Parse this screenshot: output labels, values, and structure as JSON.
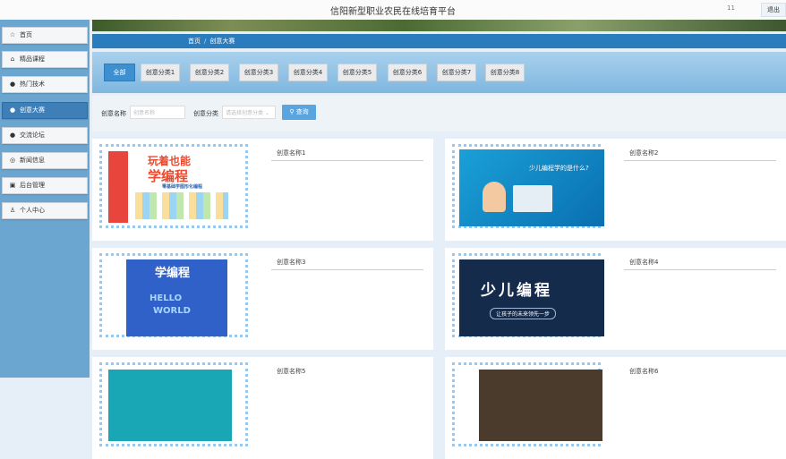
{
  "header": {
    "title": "信阳新型职业农民在线培育平台",
    "badge": "11",
    "logout": "退出"
  },
  "sidebar": {
    "items": [
      {
        "label": "首页",
        "icon": "☆"
      },
      {
        "label": "精品课程",
        "icon": "⌂"
      },
      {
        "label": "热门技术",
        "icon": "●"
      },
      {
        "label": "创意大赛",
        "icon": "●"
      },
      {
        "label": "交流论坛",
        "icon": "●"
      },
      {
        "label": "新闻信息",
        "icon": "◎"
      },
      {
        "label": "后台管理",
        "icon": "▣"
      },
      {
        "label": "个人中心",
        "icon": "♙"
      }
    ]
  },
  "breadcrumb": {
    "home": "首页",
    "separator": "/",
    "current": "创意大赛"
  },
  "tabs": [
    {
      "label": "全部"
    },
    {
      "label": "创意分类1"
    },
    {
      "label": "创意分类2"
    },
    {
      "label": "创意分类3"
    },
    {
      "label": "创意分类4"
    },
    {
      "label": "创意分类5"
    },
    {
      "label": "创意分类6"
    },
    {
      "label": "创意分类7"
    },
    {
      "label": "创意分类8"
    }
  ],
  "search": {
    "name_label": "创意名称",
    "name_placeholder": "创意名称",
    "category_label": "创意分类",
    "category_placeholder": "请选择创意分类",
    "button_label": "查询"
  },
  "cards": [
    {
      "name": "创意名称1",
      "image_text": [
        "玩着也能",
        "学编程",
        "零基础学图形化编程"
      ]
    },
    {
      "name": "创意名称2",
      "image_text": [
        "少儿编程学的是什么?"
      ]
    },
    {
      "name": "创意名称3",
      "image_text": [
        "学编程",
        "HELLO",
        "WORLD"
      ]
    },
    {
      "name": "创意名称4",
      "image_text": [
        "少儿编程",
        "让孩子的未来领先一步"
      ]
    },
    {
      "name": "创意名称5",
      "image_text": []
    },
    {
      "name": "创意名称6",
      "image_text": []
    }
  ],
  "colors": {
    "primary": "#2b7cbd",
    "active_tab": "#3d8fcf",
    "sidebar_bg": "#6aa6d0"
  }
}
